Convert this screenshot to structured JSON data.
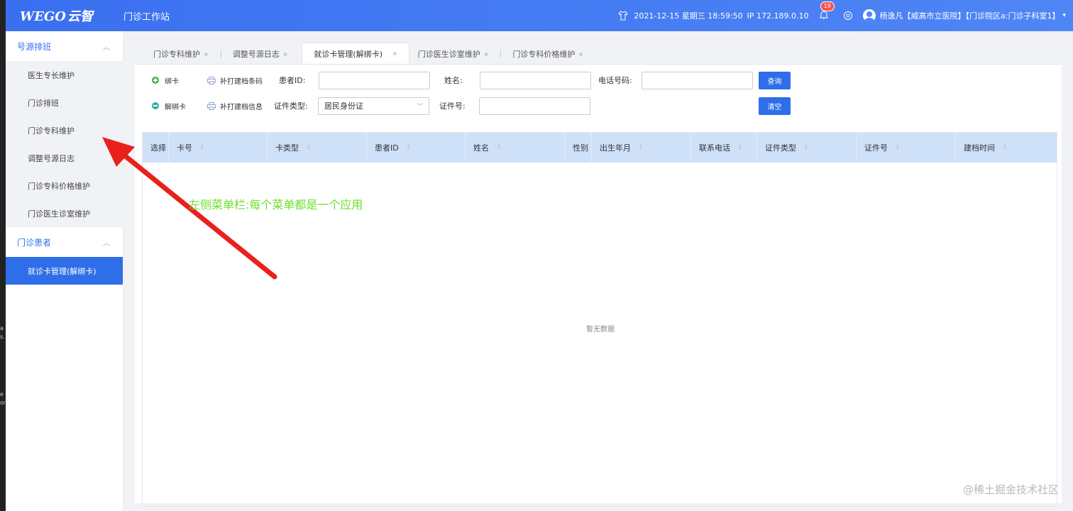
{
  "header": {
    "logo_en": "WEGO",
    "logo_cn": "云智",
    "app_title": "门诊工作站",
    "datetime": "2021-12-15 星期三 18:59:50",
    "ip": "IP 172.189.0.10",
    "notification_count": "19",
    "user": "杨逸凡【威高市立医院】【门诊院区a:门诊子科室1】",
    "caret": "▾"
  },
  "background_window": {
    "frag1": "a",
    "frag2": "s.",
    "frag3": "e",
    "frag4": "on"
  },
  "sidebar": {
    "group1": {
      "label": "号源排班",
      "chevron": "︿"
    },
    "group1_items": [
      {
        "label": "医生专长维护"
      },
      {
        "label": "门诊排班"
      },
      {
        "label": "门诊专科维护"
      },
      {
        "label": "调整号源日志"
      },
      {
        "label": "门诊专科价格维护"
      },
      {
        "label": "门诊医生诊室维护"
      }
    ],
    "group2": {
      "label": "门诊患者",
      "chevron": "︿"
    },
    "group2_items": [
      {
        "label": "就诊卡管理(解绑卡)",
        "active": true
      }
    ]
  },
  "tabs": [
    {
      "label": "门诊专科维护",
      "close": "×"
    },
    {
      "label": "调整号源日志",
      "close": "×"
    },
    {
      "label": "就诊卡管理(解绑卡)",
      "close": "×",
      "active": true
    },
    {
      "label": "门诊医生诊室维护",
      "close": "×"
    },
    {
      "label": "门诊专科价格维护",
      "close": "×"
    }
  ],
  "actions": {
    "bind_card": "绑卡",
    "reprint_barcode": "补打建档条码",
    "unbind_card": "解绑卡",
    "reprint_info": "补打建档信息"
  },
  "form": {
    "patient_id_label": "患者ID:",
    "patient_id_value": "",
    "name_label": "姓名:",
    "name_value": "",
    "phone_label": "电话号码:",
    "phone_value": "",
    "id_type_label": "证件类型:",
    "id_type_value": "居民身份证",
    "id_no_label": "证件号:",
    "id_no_value": "",
    "query_button": "查询",
    "clear_button": "清空"
  },
  "table": {
    "columns": [
      "选择",
      "卡号",
      "卡类型",
      "患者ID",
      "姓名",
      "性别",
      "出生年月",
      "联系电话",
      "证件类型",
      "证件号",
      "建档时间"
    ],
    "sortable": [
      false,
      true,
      true,
      true,
      true,
      false,
      true,
      true,
      true,
      true,
      true
    ],
    "sort_glyph": "⇕",
    "empty_text": "暂无数据"
  },
  "annotation": {
    "text": "左侧菜单栏:每个菜单都是一个应用",
    "color": "#6ddf2a",
    "arrow_color": "#e8211c"
  },
  "watermark": "@稀土掘金技术社区",
  "colors": {
    "primary": "#2f6ee9",
    "header_gradient_start": "#3a6ff0",
    "table_header_bg": "#cfe0f9"
  }
}
